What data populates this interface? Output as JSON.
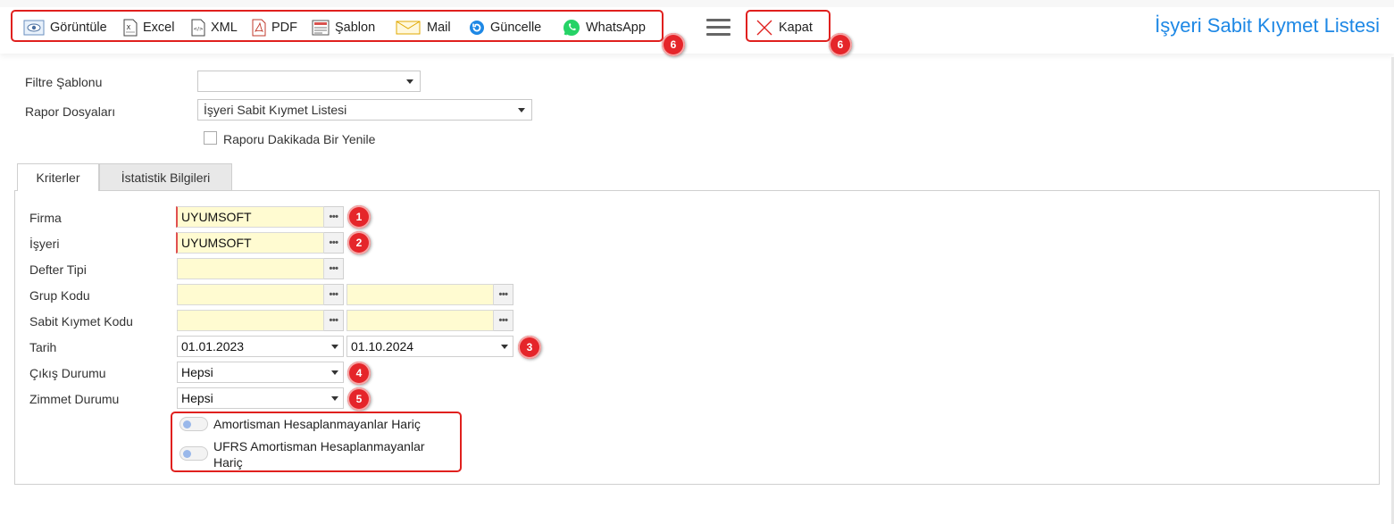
{
  "toolbar": {
    "buttons": [
      {
        "label": "Görüntüle",
        "icon": "view-icon"
      },
      {
        "label": "Excel",
        "icon": "excel-icon"
      },
      {
        "label": "XML",
        "icon": "xml-icon"
      },
      {
        "label": "PDF",
        "icon": "pdf-icon"
      },
      {
        "label": "Şablon",
        "icon": "template-icon"
      },
      {
        "label": "Mail",
        "icon": "mail-icon"
      },
      {
        "label": "Güncelle",
        "icon": "refresh-icon"
      },
      {
        "label": "WhatsApp",
        "icon": "whatsapp-icon"
      }
    ],
    "menu_icon": "hamburger-icon",
    "close": {
      "label": "Kapat",
      "icon": "close-icon"
    }
  },
  "page_title": "İşyeri Sabit Kıymet Listesi",
  "filters": {
    "filter_template_label": "Filtre Şablonu",
    "filter_template_value": "",
    "report_files_label": "Rapor Dosyaları",
    "report_files_value": "İşyeri Sabit Kıymet Listesi",
    "auto_refresh_label": "Raporu Dakikada Bir Yenile",
    "auto_refresh_checked": false
  },
  "tabs": [
    {
      "label": "Kriterler",
      "active": true
    },
    {
      "label": "İstatistik Bilgileri",
      "active": false
    }
  ],
  "criteria": {
    "firma": {
      "label": "Firma",
      "value": "UYUMSOFT"
    },
    "isyeri": {
      "label": "İşyeri",
      "value": "UYUMSOFT"
    },
    "defter_tipi": {
      "label": "Defter Tipi",
      "value": ""
    },
    "grup_kodu": {
      "label": "Grup Kodu",
      "from": "",
      "to": ""
    },
    "sabit_kiymet_kodu": {
      "label": "Sabit Kıymet Kodu",
      "from": "",
      "to": ""
    },
    "tarih": {
      "label": "Tarih",
      "from": "01.01.2023",
      "to": "01.10.2024"
    },
    "cikis_durumu": {
      "label": "Çıkış Durumu",
      "value": "Hepsi"
    },
    "zimmet_durumu": {
      "label": "Zimmet Durumu",
      "value": "Hepsi"
    },
    "toggles": [
      {
        "label": "Amortisman Hesaplanmayanlar Hariç",
        "on": false
      },
      {
        "label": "UFRS Amortisman Hesaplanmayanlar Hariç",
        "on": false
      }
    ]
  },
  "annotations": {
    "badges": [
      "1",
      "2",
      "3",
      "4",
      "5",
      "6",
      "6"
    ],
    "color": "#e5252a"
  },
  "colors": {
    "accent": "#1e88e5",
    "field_bg": "#fffbd1",
    "highlight": "#e0201e"
  }
}
